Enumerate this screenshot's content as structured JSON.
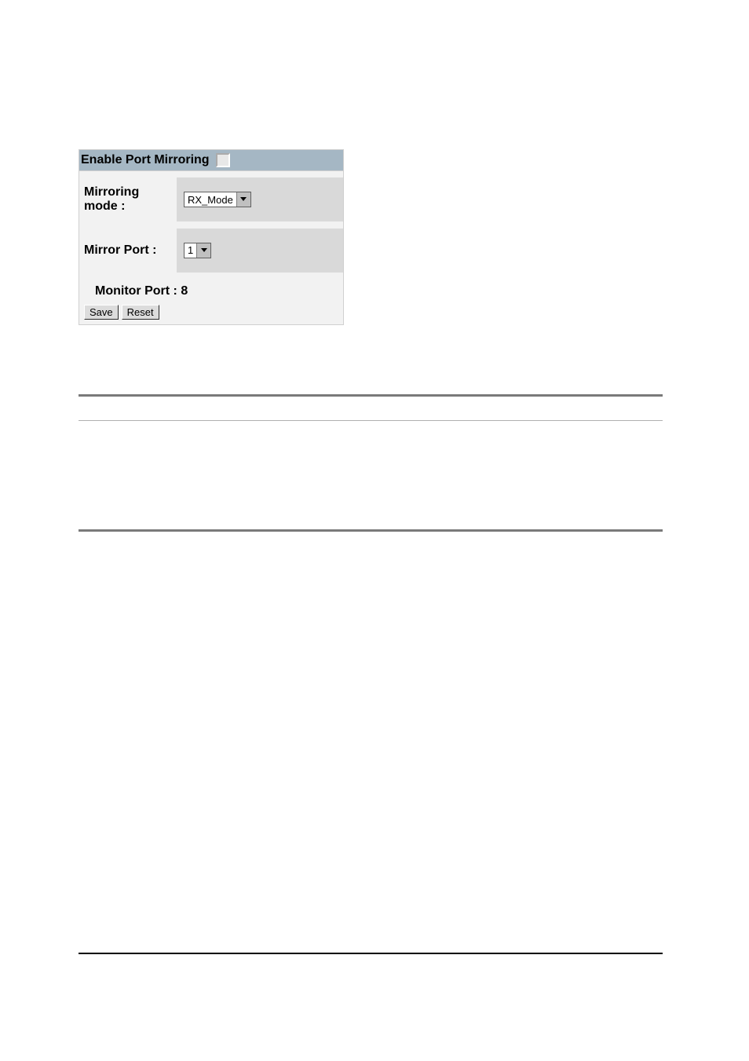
{
  "header": {
    "title": "Enable Port Mirroring"
  },
  "fields": {
    "mirroring_mode_label": "Mirroring mode :",
    "mirroring_mode_value": "RX_Mode",
    "mirror_port_label": "Mirror Port :",
    "mirror_port_value": "1",
    "monitor_port_label": "Monitor Port : 8"
  },
  "buttons": {
    "save": "Save",
    "reset": "Reset"
  }
}
